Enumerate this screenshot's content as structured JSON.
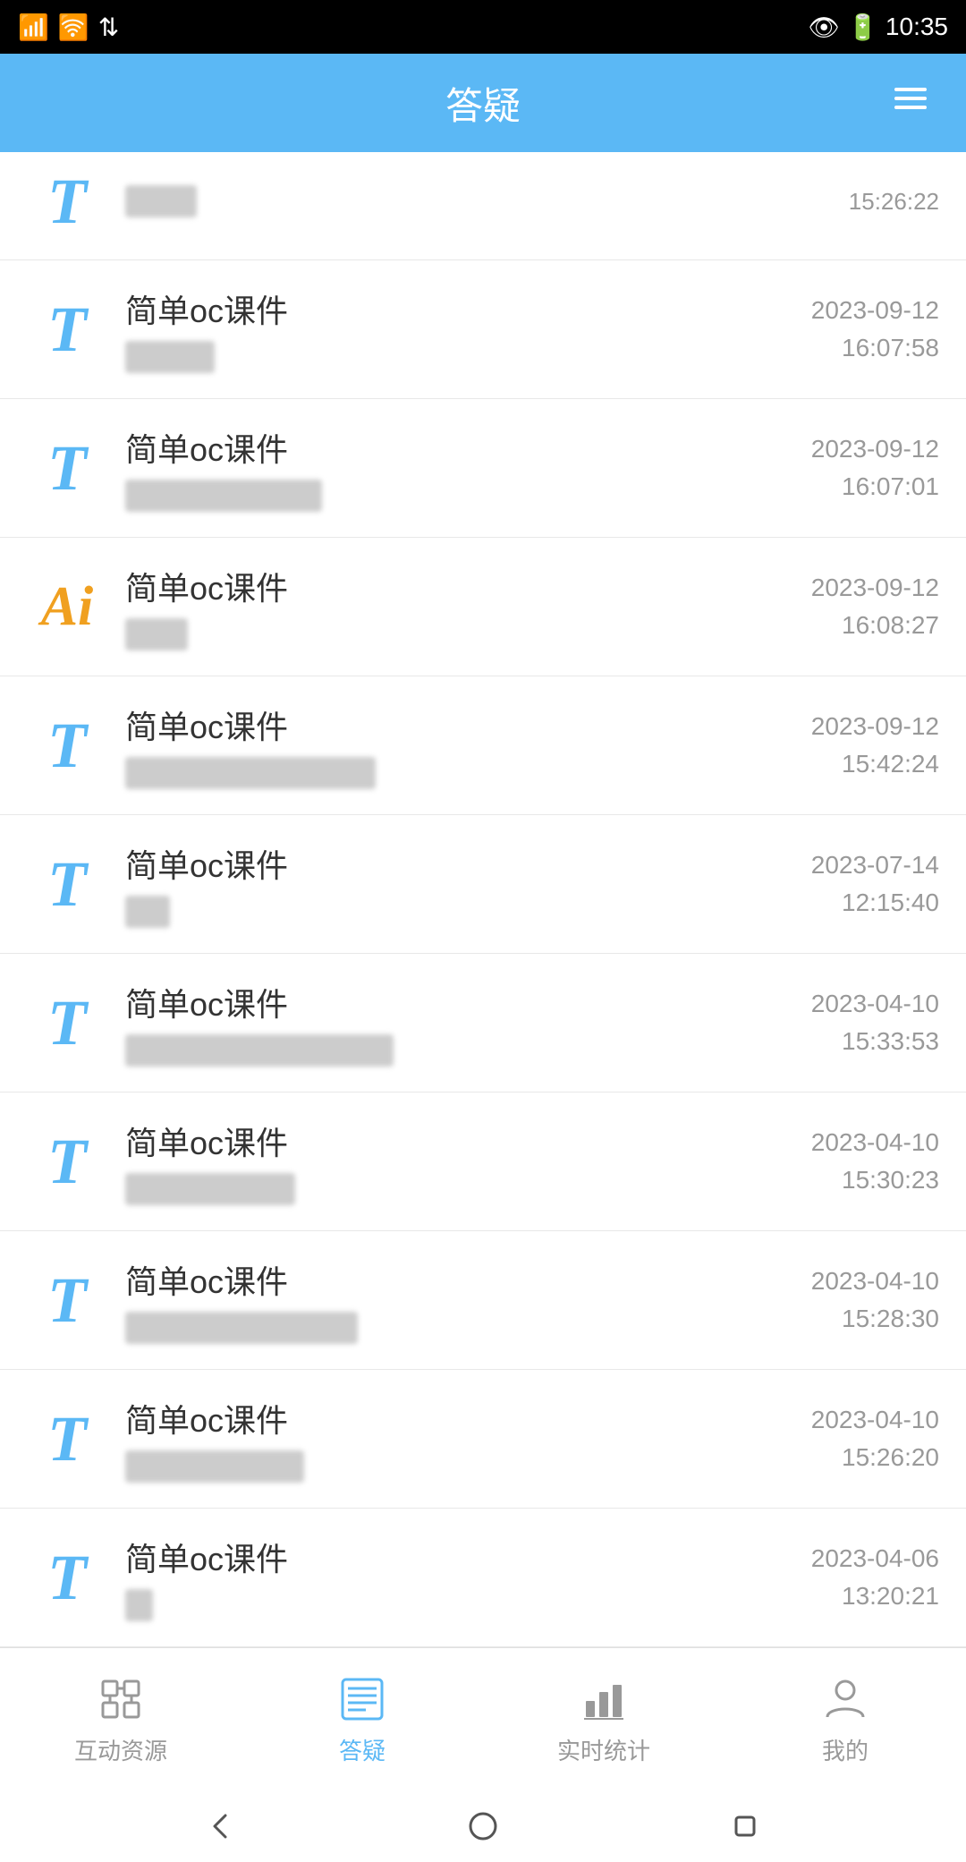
{
  "statusBar": {
    "battery": "98",
    "time": "10:35"
  },
  "header": {
    "title": "答疑",
    "menuIcon": "≡"
  },
  "listItems": [
    {
      "id": 0,
      "iconType": "T",
      "title": "",
      "subtitle": "blurred",
      "date": "15:26:22",
      "datePrefix": "",
      "partial": true
    },
    {
      "id": 1,
      "iconType": "T",
      "title": "简单oc课件",
      "subtitle": "blurred_short",
      "date": "2023-09-12\n16:07:58"
    },
    {
      "id": 2,
      "iconType": "T",
      "title": "简单oc课件",
      "subtitle": "blurred_long",
      "date": "2023-09-12\n16:07:01"
    },
    {
      "id": 3,
      "iconType": "Ai",
      "title": "简单oc课件",
      "subtitle": "blurred_tiny",
      "date": "2023-09-12\n16:08:27"
    },
    {
      "id": 4,
      "iconType": "T",
      "title": "简单oc课件",
      "subtitle": "blurred_medium",
      "date": "2023-09-12\n15:42:24"
    },
    {
      "id": 5,
      "iconType": "T",
      "title": "简单oc课件",
      "subtitle": "blurred_tiny2",
      "date": "2023-07-14\n12:15:40"
    },
    {
      "id": 6,
      "iconType": "T",
      "title": "简单oc课件",
      "subtitle": "blurred_long2",
      "date": "2023-04-10\n15:33:53"
    },
    {
      "id": 7,
      "iconType": "T",
      "title": "简单oc课件",
      "subtitle": "blurred_medium2",
      "date": "2023-04-10\n15:30:23"
    },
    {
      "id": 8,
      "iconType": "T",
      "title": "简单oc课件",
      "subtitle": "blurred_long3",
      "date": "2023-04-10\n15:28:30"
    },
    {
      "id": 9,
      "iconType": "T",
      "title": "简单oc课件",
      "subtitle": "blurred_medium3",
      "date": "2023-04-10\n15:26:20"
    },
    {
      "id": 10,
      "iconType": "T",
      "title": "简单oc课件",
      "subtitle": "blurred_dot",
      "date": "2023-04-06\n13:20:21"
    }
  ],
  "bottomNav": {
    "items": [
      {
        "id": "interactive",
        "label": "互动资源",
        "active": false
      },
      {
        "id": "qa",
        "label": "答疑",
        "active": true
      },
      {
        "id": "stats",
        "label": "实时统计",
        "active": false
      },
      {
        "id": "mine",
        "label": "我的",
        "active": false
      }
    ]
  },
  "androidNav": {
    "back": "◁",
    "home": "○",
    "recent": "□"
  }
}
